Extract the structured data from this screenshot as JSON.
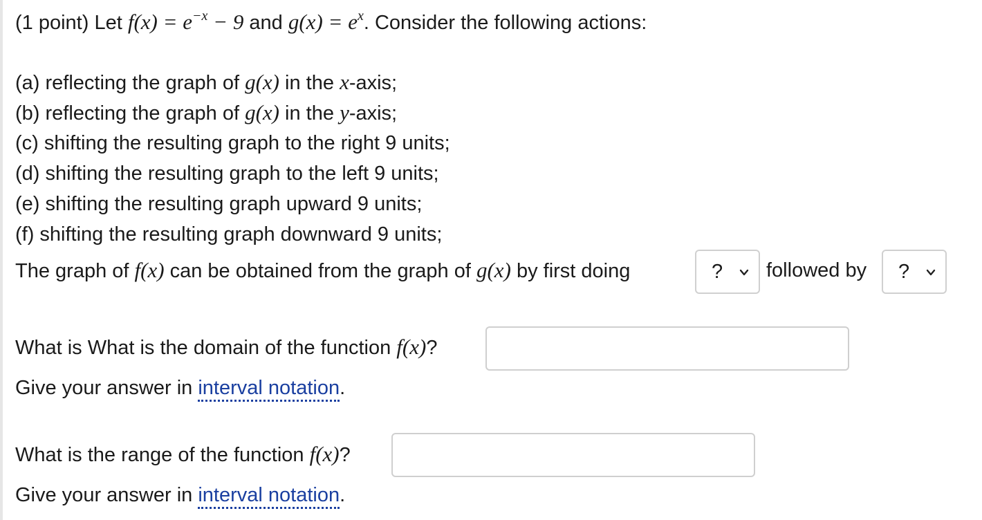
{
  "problem": {
    "intro_prefix": "(1 point) Let",
    "f_def_lhs": "f(x)",
    "f_def_eq": " = ",
    "f_def_base": "e",
    "f_def_exp": "−x",
    "f_def_rest": " − 9",
    "and_text": "and",
    "g_def_lhs": "g(x)",
    "g_def_eq": " = ",
    "g_def_base": "e",
    "g_def_exp": "x",
    "intro_suffix": ". Consider the following actions:",
    "actions": [
      {
        "prefix": "(a) reflecting the graph of",
        "math": "g(x)",
        "mid": "in the",
        "var": "x",
        "suffix": "-axis;"
      },
      {
        "prefix": "(b) reflecting the graph of",
        "math": "g(x)",
        "mid": "in the",
        "var": "y",
        "suffix": "-axis;"
      },
      {
        "text": "(c) shifting the resulting graph to the right 9 units;"
      },
      {
        "text": "(d) shifting the resulting graph to the left 9 units;"
      },
      {
        "text": "(e) shifting the resulting graph upward 9 units;"
      },
      {
        "text": "(f) shifting the resulting graph downward 9 units;"
      }
    ],
    "sentence_prefix": "The graph of",
    "sentence_f": "f(x)",
    "sentence_mid": "can be obtained from the graph of",
    "sentence_g": "g(x)",
    "sentence_suffix": "by first doing",
    "followed_by": "followed by",
    "select1_value": "?",
    "select2_value": "?"
  },
  "domain_q": {
    "prefix": "What is What is the domain of the function",
    "math": "f(x)",
    "suffix": "?",
    "hint_prefix": "Give your answer in",
    "hint_link": "interval notation",
    "hint_suffix": ".",
    "value": ""
  },
  "range_q": {
    "prefix": "What is the range of the function",
    "math": "f(x)",
    "suffix": "?",
    "hint_prefix": "Give your answer in",
    "hint_link": "interval notation",
    "hint_suffix": ".",
    "value": ""
  },
  "icons": {
    "dropdown": "chevron-down-icon"
  }
}
